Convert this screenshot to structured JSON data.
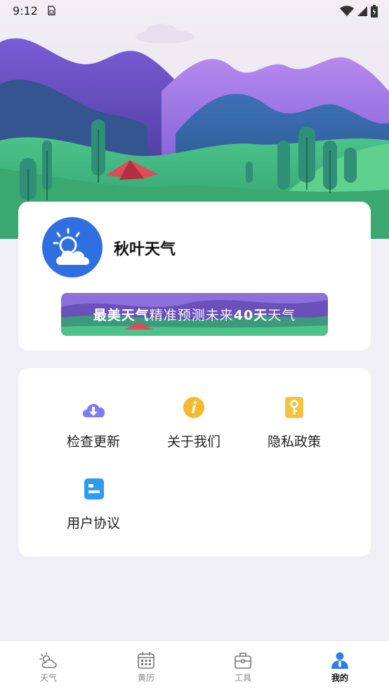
{
  "status_bar": {
    "time": "9:12",
    "icons": [
      "sim-card-icon",
      "wifi-icon",
      "cellular-signal-icon",
      "battery-icon"
    ]
  },
  "profile": {
    "app_name": "秋叶天气",
    "avatar_icon": "sun-cloud-icon",
    "avatar_color": "#2f6fe0",
    "banner": {
      "part1": "最美天气",
      "part2": "精准预测未来",
      "part3": "40天",
      "part4": "天气"
    }
  },
  "menu": {
    "items": [
      {
        "label": "检查更新",
        "icon": "cloud-download-icon",
        "color": "#7b7df2"
      },
      {
        "label": "关于我们",
        "icon": "info-icon",
        "color": "#f5b82e"
      },
      {
        "label": "隐私政策",
        "icon": "key-icon",
        "color": "#f7c23c"
      },
      {
        "label": "用户协议",
        "icon": "document-icon",
        "color": "#2d9bf0"
      }
    ]
  },
  "tab_bar": {
    "tabs": [
      {
        "label": "天气",
        "icon": "weather-icon",
        "active": false
      },
      {
        "label": "黄历",
        "icon": "calendar-icon",
        "active": false
      },
      {
        "label": "工具",
        "icon": "toolbox-icon",
        "active": false
      },
      {
        "label": "我的",
        "icon": "profile-icon",
        "active": true
      }
    ],
    "active_color": "#2f7ee8"
  }
}
